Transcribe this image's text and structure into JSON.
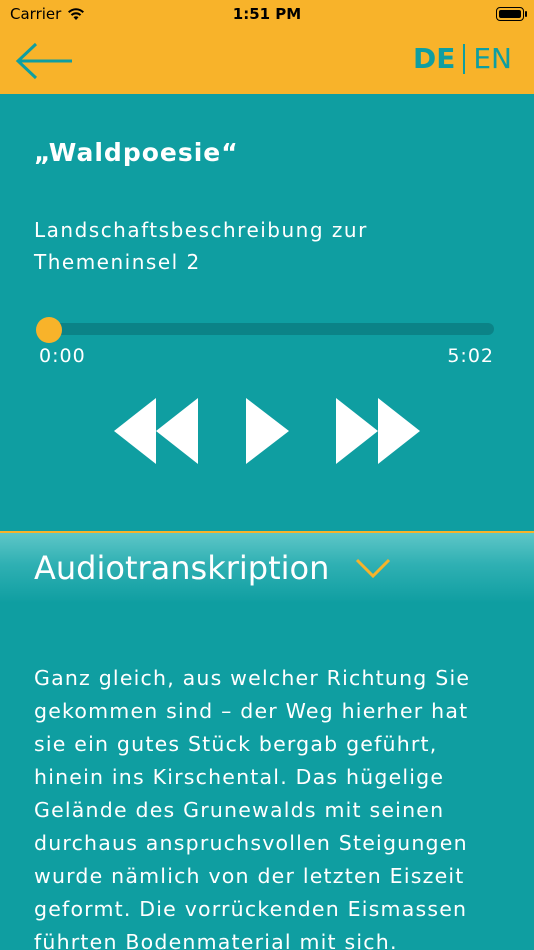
{
  "status": {
    "carrier": "Carrier",
    "time": "1:51 PM"
  },
  "header": {
    "lang_de": "DE",
    "lang_en": "EN"
  },
  "player": {
    "title": "„Waldpoesie“",
    "subtitle": "Landschaftsbeschreibung zur Themeninsel 2",
    "current_time": "0:00",
    "total_time": "5:02",
    "progress": 0
  },
  "transcript": {
    "label": "Audiotranskription",
    "text": "Ganz gleich, aus welcher Richtung Sie gekommen sind – der Weg hierher hat sie ein gutes Stück bergab geführt, hinein ins Kirschental. Das hügelige Gelände des Grunewalds mit seinen durchaus anspruchsvollen Steigungen wurde nämlich von der letzten Eiszeit geformt. Die vorrückenden Eismassen führten Bodenmaterial mit sich."
  },
  "colors": {
    "accent": "#f8b32a",
    "background": "#0f9ea1",
    "track": "#0b8387"
  },
  "icons": [
    "wifi-icon",
    "battery-icon",
    "back-arrow-icon",
    "rewind-icon",
    "play-icon",
    "fast-forward-icon",
    "chevron-down-icon"
  ]
}
